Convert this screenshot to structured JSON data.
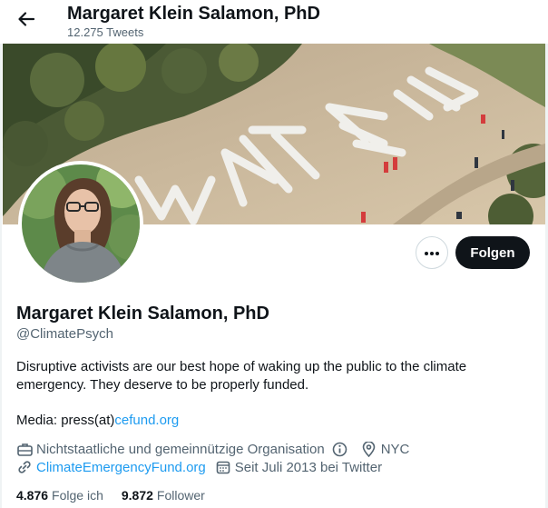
{
  "header": {
    "back_icon": "arrow-left-icon",
    "title": "Margaret Klein Salamon, PhD",
    "tweet_count": "12.275 Tweets"
  },
  "profile": {
    "name": "Margaret Klein Salamon, PhD",
    "handle": "@ClimatePsych",
    "bio": "Disruptive activists are our best hope of waking up the public to the climate emergency. They deserve to be properly funded.",
    "media_prefix": "Media: press(at)",
    "media_link": "cefund.org",
    "category": "Nichtstaatliche und gemeinnützige Organisation",
    "location": "NYC",
    "website": "ClimateEmergencyFund.org",
    "joined": "Seit Juli 2013 bei Twitter",
    "following_count": "4.876",
    "following_label": "Folge ich",
    "followers_count": "9.872",
    "followers_label": "Follower"
  },
  "actions": {
    "more_icon": "more-horizontal-icon",
    "follow_label": "Folgen"
  },
  "colors": {
    "accent": "#1d9bf0",
    "text_primary": "#0f1419",
    "text_secondary": "#536471",
    "follow_bg": "#0f1419"
  }
}
